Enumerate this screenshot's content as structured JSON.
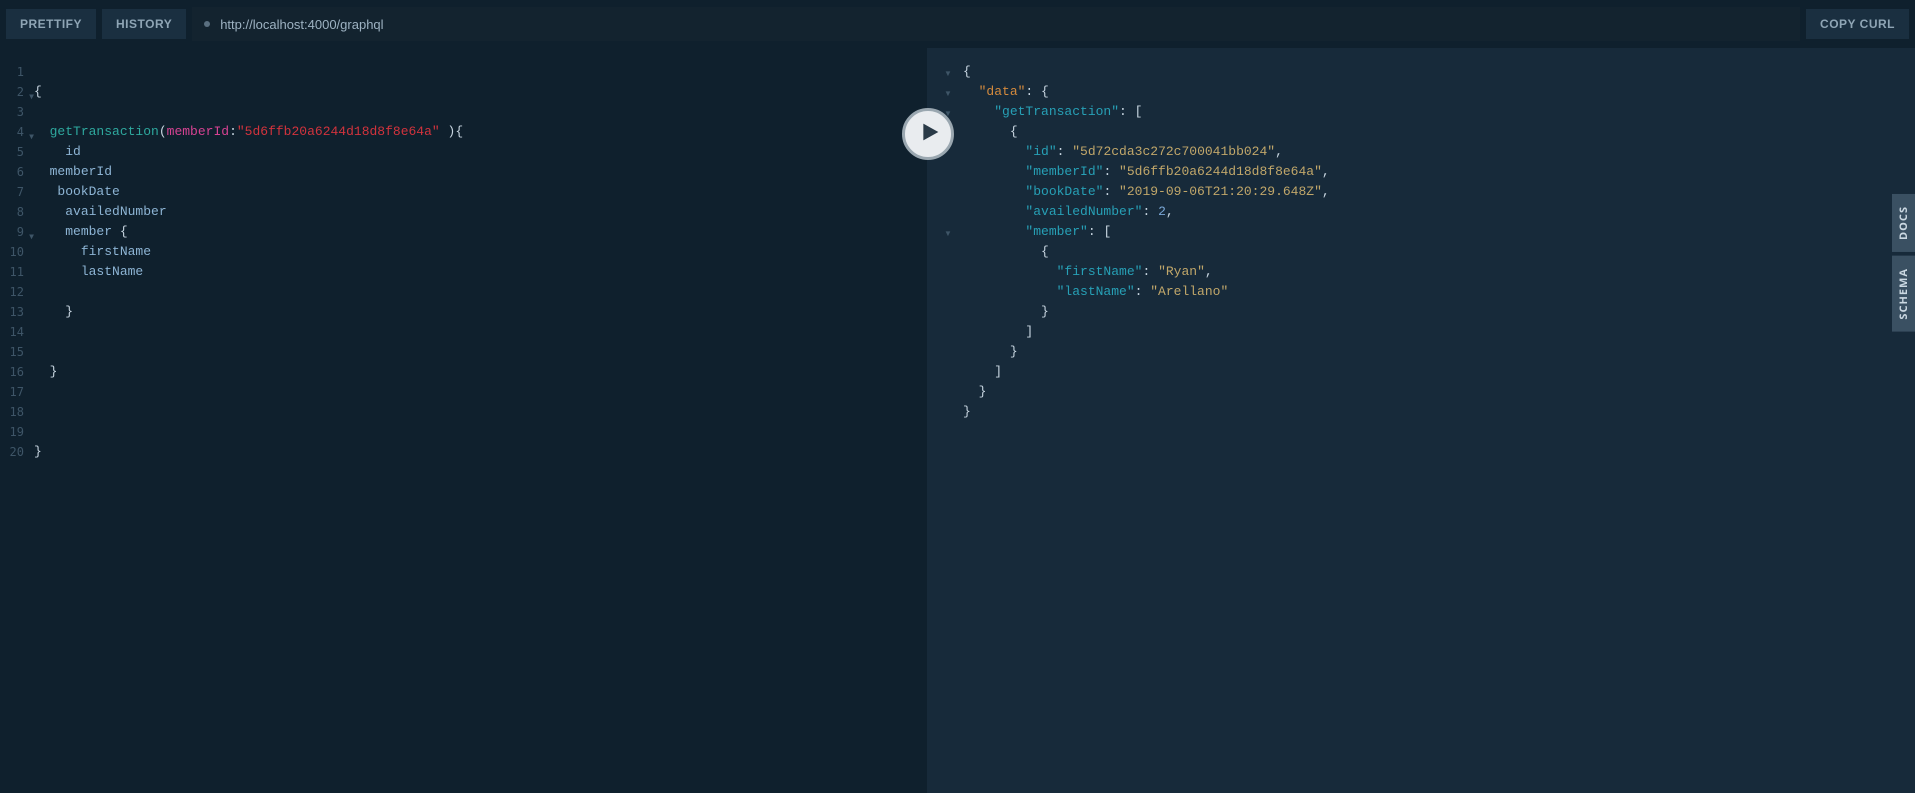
{
  "toolbar": {
    "prettify_label": "PRETTIFY",
    "history_label": "HISTORY",
    "copy_curl_label": "COPY CURL",
    "endpoint": "http://localhost:4000/graphql"
  },
  "side_tabs": {
    "docs": "DOCS",
    "schema": "SCHEMA"
  },
  "query": {
    "lines": [
      {
        "n": 1,
        "fold": false,
        "tokens": []
      },
      {
        "n": 2,
        "fold": true,
        "tokens": [
          {
            "t": "{",
            "c": "tok-punc"
          }
        ]
      },
      {
        "n": 3,
        "fold": false,
        "tokens": []
      },
      {
        "n": 4,
        "fold": true,
        "tokens": [
          {
            "t": "  ",
            "c": ""
          },
          {
            "t": "getTransaction",
            "c": "tok-def"
          },
          {
            "t": "(",
            "c": "tok-punc"
          },
          {
            "t": "memberId",
            "c": "tok-arg"
          },
          {
            "t": ":",
            "c": "tok-punc"
          },
          {
            "t": "\"5d6ffb20a6244d18d8f8e64a\"",
            "c": "tok-string"
          },
          {
            "t": " )",
            "c": "tok-punc"
          },
          {
            "t": "{",
            "c": "tok-punc"
          }
        ]
      },
      {
        "n": 5,
        "fold": false,
        "tokens": [
          {
            "t": "    ",
            "c": ""
          },
          {
            "t": "id",
            "c": "tok-attr"
          }
        ]
      },
      {
        "n": 6,
        "fold": false,
        "tokens": [
          {
            "t": "  ",
            "c": ""
          },
          {
            "t": "memberId",
            "c": "tok-attr"
          }
        ]
      },
      {
        "n": 7,
        "fold": false,
        "tokens": [
          {
            "t": "   ",
            "c": ""
          },
          {
            "t": "bookDate",
            "c": "tok-attr"
          }
        ]
      },
      {
        "n": 8,
        "fold": false,
        "tokens": [
          {
            "t": "    ",
            "c": ""
          },
          {
            "t": "availedNumber",
            "c": "tok-attr"
          }
        ]
      },
      {
        "n": 9,
        "fold": true,
        "tokens": [
          {
            "t": "    ",
            "c": ""
          },
          {
            "t": "member",
            "c": "tok-attr"
          },
          {
            "t": " {",
            "c": "tok-punc"
          }
        ]
      },
      {
        "n": 10,
        "fold": false,
        "tokens": [
          {
            "t": "      ",
            "c": ""
          },
          {
            "t": "firstName",
            "c": "tok-attr"
          }
        ]
      },
      {
        "n": 11,
        "fold": false,
        "tokens": [
          {
            "t": "      ",
            "c": ""
          },
          {
            "t": "lastName",
            "c": "tok-attr"
          }
        ]
      },
      {
        "n": 12,
        "fold": false,
        "tokens": []
      },
      {
        "n": 13,
        "fold": false,
        "tokens": [
          {
            "t": "    }",
            "c": "tok-punc"
          }
        ]
      },
      {
        "n": 14,
        "fold": false,
        "tokens": []
      },
      {
        "n": 15,
        "fold": false,
        "tokens": []
      },
      {
        "n": 16,
        "fold": false,
        "tokens": [
          {
            "t": "  }",
            "c": "tok-punc"
          }
        ]
      },
      {
        "n": 17,
        "fold": false,
        "tokens": []
      },
      {
        "n": 18,
        "fold": false,
        "tokens": []
      },
      {
        "n": 19,
        "fold": false,
        "tokens": []
      },
      {
        "n": 20,
        "fold": false,
        "tokens": [
          {
            "t": "}",
            "c": "tok-punc"
          }
        ]
      }
    ]
  },
  "response": {
    "lines": [
      {
        "fold": true,
        "indent": 0,
        "tokens": [
          {
            "t": "{",
            "c": "tok-punc"
          }
        ]
      },
      {
        "fold": true,
        "indent": 1,
        "tokens": [
          {
            "t": "\"data\"",
            "c": "tok-rootkey"
          },
          {
            "t": ": {",
            "c": "tok-punc"
          }
        ]
      },
      {
        "fold": true,
        "indent": 2,
        "tokens": [
          {
            "t": "\"getTransaction\"",
            "c": "tok-key"
          },
          {
            "t": ": [",
            "c": "tok-punc"
          }
        ]
      },
      {
        "fold": true,
        "indent": 3,
        "tokens": [
          {
            "t": "{",
            "c": "tok-punc"
          }
        ]
      },
      {
        "fold": false,
        "indent": 4,
        "tokens": [
          {
            "t": "\"id\"",
            "c": "tok-key"
          },
          {
            "t": ": ",
            "c": "tok-punc"
          },
          {
            "t": "\"5d72cda3c272c700041bb024\"",
            "c": "tok-val-str"
          },
          {
            "t": ",",
            "c": "tok-punc"
          }
        ]
      },
      {
        "fold": false,
        "indent": 4,
        "tokens": [
          {
            "t": "\"memberId\"",
            "c": "tok-key"
          },
          {
            "t": ": ",
            "c": "tok-punc"
          },
          {
            "t": "\"5d6ffb20a6244d18d8f8e64a\"",
            "c": "tok-val-str"
          },
          {
            "t": ",",
            "c": "tok-punc"
          }
        ]
      },
      {
        "fold": false,
        "indent": 4,
        "tokens": [
          {
            "t": "\"bookDate\"",
            "c": "tok-key"
          },
          {
            "t": ": ",
            "c": "tok-punc"
          },
          {
            "t": "\"2019-09-06T21:20:29.648Z\"",
            "c": "tok-val-str"
          },
          {
            "t": ",",
            "c": "tok-punc"
          }
        ]
      },
      {
        "fold": false,
        "indent": 4,
        "tokens": [
          {
            "t": "\"availedNumber\"",
            "c": "tok-key"
          },
          {
            "t": ": ",
            "c": "tok-punc"
          },
          {
            "t": "2",
            "c": "tok-val-num"
          },
          {
            "t": ",",
            "c": "tok-punc"
          }
        ]
      },
      {
        "fold": true,
        "indent": 4,
        "tokens": [
          {
            "t": "\"member\"",
            "c": "tok-key"
          },
          {
            "t": ": [",
            "c": "tok-punc"
          }
        ]
      },
      {
        "fold": false,
        "indent": 5,
        "tokens": [
          {
            "t": "{",
            "c": "tok-punc"
          }
        ]
      },
      {
        "fold": false,
        "indent": 6,
        "tokens": [
          {
            "t": "\"firstName\"",
            "c": "tok-key"
          },
          {
            "t": ": ",
            "c": "tok-punc"
          },
          {
            "t": "\"Ryan\"",
            "c": "tok-val-str"
          },
          {
            "t": ",",
            "c": "tok-punc"
          }
        ]
      },
      {
        "fold": false,
        "indent": 6,
        "tokens": [
          {
            "t": "\"lastName\"",
            "c": "tok-key"
          },
          {
            "t": ": ",
            "c": "tok-punc"
          },
          {
            "t": "\"Arellano\"",
            "c": "tok-val-str"
          }
        ]
      },
      {
        "fold": false,
        "indent": 5,
        "tokens": [
          {
            "t": "}",
            "c": "tok-punc"
          }
        ]
      },
      {
        "fold": false,
        "indent": 4,
        "tokens": [
          {
            "t": "]",
            "c": "tok-punc"
          }
        ]
      },
      {
        "fold": false,
        "indent": 3,
        "tokens": [
          {
            "t": "}",
            "c": "tok-punc"
          }
        ]
      },
      {
        "fold": false,
        "indent": 2,
        "tokens": [
          {
            "t": "]",
            "c": "tok-punc"
          }
        ]
      },
      {
        "fold": false,
        "indent": 1,
        "tokens": [
          {
            "t": "}",
            "c": "tok-punc"
          }
        ]
      },
      {
        "fold": false,
        "indent": 0,
        "tokens": [
          {
            "t": "}",
            "c": "tok-punc"
          }
        ]
      }
    ]
  }
}
